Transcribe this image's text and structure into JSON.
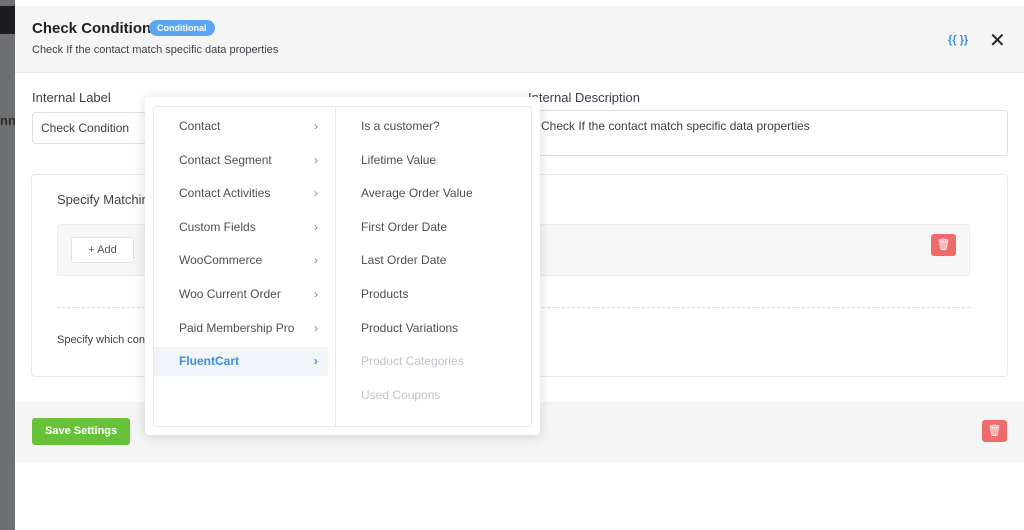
{
  "background": {
    "partial_text": "nn"
  },
  "header": {
    "title": "Check Condition",
    "badge": "Conditional",
    "subtitle": "Check If the contact match specific data properties",
    "smartcode_icon": "{{ }}",
    "close_icon": "✕"
  },
  "form": {
    "internal_label": "Internal Label",
    "internal_label_value": "Check Condition",
    "internal_description": "Internal Description",
    "internal_description_value": "Check If the contact match specific data properties"
  },
  "conditions": {
    "title": "Specify Matching Conditions",
    "add_label": "Add",
    "help_text": "Specify which contact properties need to match to run the condition blocks or no blocks"
  },
  "footer": {
    "save_label": "Save Settings"
  },
  "menu": {
    "categories": [
      {
        "label": "Contact"
      },
      {
        "label": "Contact Segment"
      },
      {
        "label": "Contact Activities"
      },
      {
        "label": "Custom Fields"
      },
      {
        "label": "WooCommerce"
      },
      {
        "label": "Woo Current Order"
      },
      {
        "label": "Paid Membership Pro"
      },
      {
        "label": "FluentCart",
        "active": true
      }
    ],
    "options": [
      {
        "label": "Is a customer?"
      },
      {
        "label": "Lifetime Value"
      },
      {
        "label": "Average Order Value"
      },
      {
        "label": "First Order Date"
      },
      {
        "label": "Last Order Date"
      },
      {
        "label": "Products"
      },
      {
        "label": "Product Variations"
      },
      {
        "label": "Product Categories",
        "disabled": true
      },
      {
        "label": "Used Coupons",
        "disabled": true
      }
    ]
  },
  "colors": {
    "accent": "#3a8ee6",
    "success": "#67c23a",
    "danger": "#ef6b6b",
    "badge": "#5aa6f2"
  }
}
